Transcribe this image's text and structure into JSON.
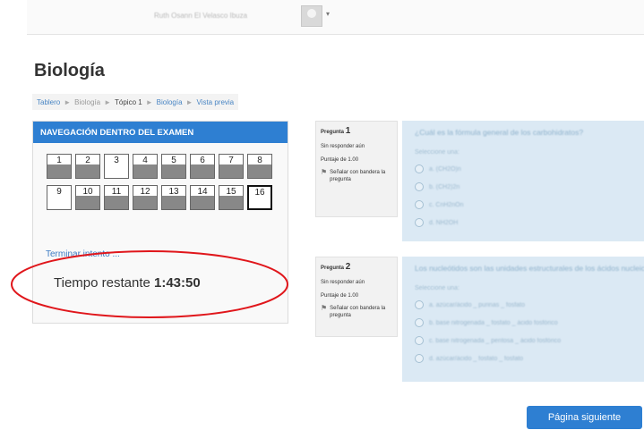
{
  "header": {
    "user_name": "Ruth Osann El Velasco Ibuza",
    "menu_caret": "▾"
  },
  "page": {
    "title": "Biología"
  },
  "breadcrumb": {
    "items": [
      "Tablero",
      "Biología",
      "Tópico 1",
      "Biología",
      "Vista previa"
    ],
    "separator": "►"
  },
  "quiz_nav": {
    "title": "NAVEGACIÓN DENTRO DEL EXAMEN",
    "questions": [
      {
        "label": "1",
        "state": "unanswered"
      },
      {
        "label": "2",
        "state": "unanswered"
      },
      {
        "label": "3",
        "state": "answered"
      },
      {
        "label": "4",
        "state": "unanswered"
      },
      {
        "label": "5",
        "state": "unanswered"
      },
      {
        "label": "6",
        "state": "unanswered"
      },
      {
        "label": "7",
        "state": "unanswered"
      },
      {
        "label": "8",
        "state": "unanswered"
      },
      {
        "label": "9",
        "state": "answered"
      },
      {
        "label": "10",
        "state": "unanswered"
      },
      {
        "label": "11",
        "state": "unanswered"
      },
      {
        "label": "12",
        "state": "unanswered"
      },
      {
        "label": "13",
        "state": "unanswered"
      },
      {
        "label": "14",
        "state": "unanswered"
      },
      {
        "label": "15",
        "state": "unanswered"
      },
      {
        "label": "16",
        "state": "current"
      }
    ],
    "finish_link": "Terminar intento ...",
    "timer_label": "Tiempo restante",
    "timer_value": "1:43:50",
    "highlight_color": "#e0161b"
  },
  "questions": [
    {
      "label": "Pregunta",
      "number": "1",
      "status": "Sin responder aún",
      "score": "Puntaje de 1.00",
      "flag_text": "Señalar con bandera la pregunta",
      "text": "¿Cuál es la fórmula general de los carbohidratos?",
      "select_one": "Seleccione una:",
      "options": [
        "a. (CH2O)n",
        "b. (CH2)2n",
        "c. CnH2nOn",
        "d. NH2OH"
      ]
    },
    {
      "label": "Pregunta",
      "number": "2",
      "status": "Sin responder aún",
      "score": "Puntaje de 1.00",
      "flag_text": "Señalar con bandera la pregunta",
      "text": "Los nucleótidos son las unidades estructurales de los ácidos nucleicos...",
      "select_one": "Seleccione una:",
      "options": [
        "a. azúcar/ácido _ purinas _ fosfato",
        "b. base nitrogenada _ fosfato _ ácido fosfórico",
        "c. base nitrogenada _ pentosa _ ácido fosfórico",
        "d. azúcar/ácido _ fosfato _ fosfato"
      ]
    }
  ],
  "footer": {
    "next_page": "Página siguiente"
  },
  "colors": {
    "primary": "#2e7fd2",
    "question_bg": "#dbe9f4",
    "info_bg": "#f2f2f2"
  }
}
